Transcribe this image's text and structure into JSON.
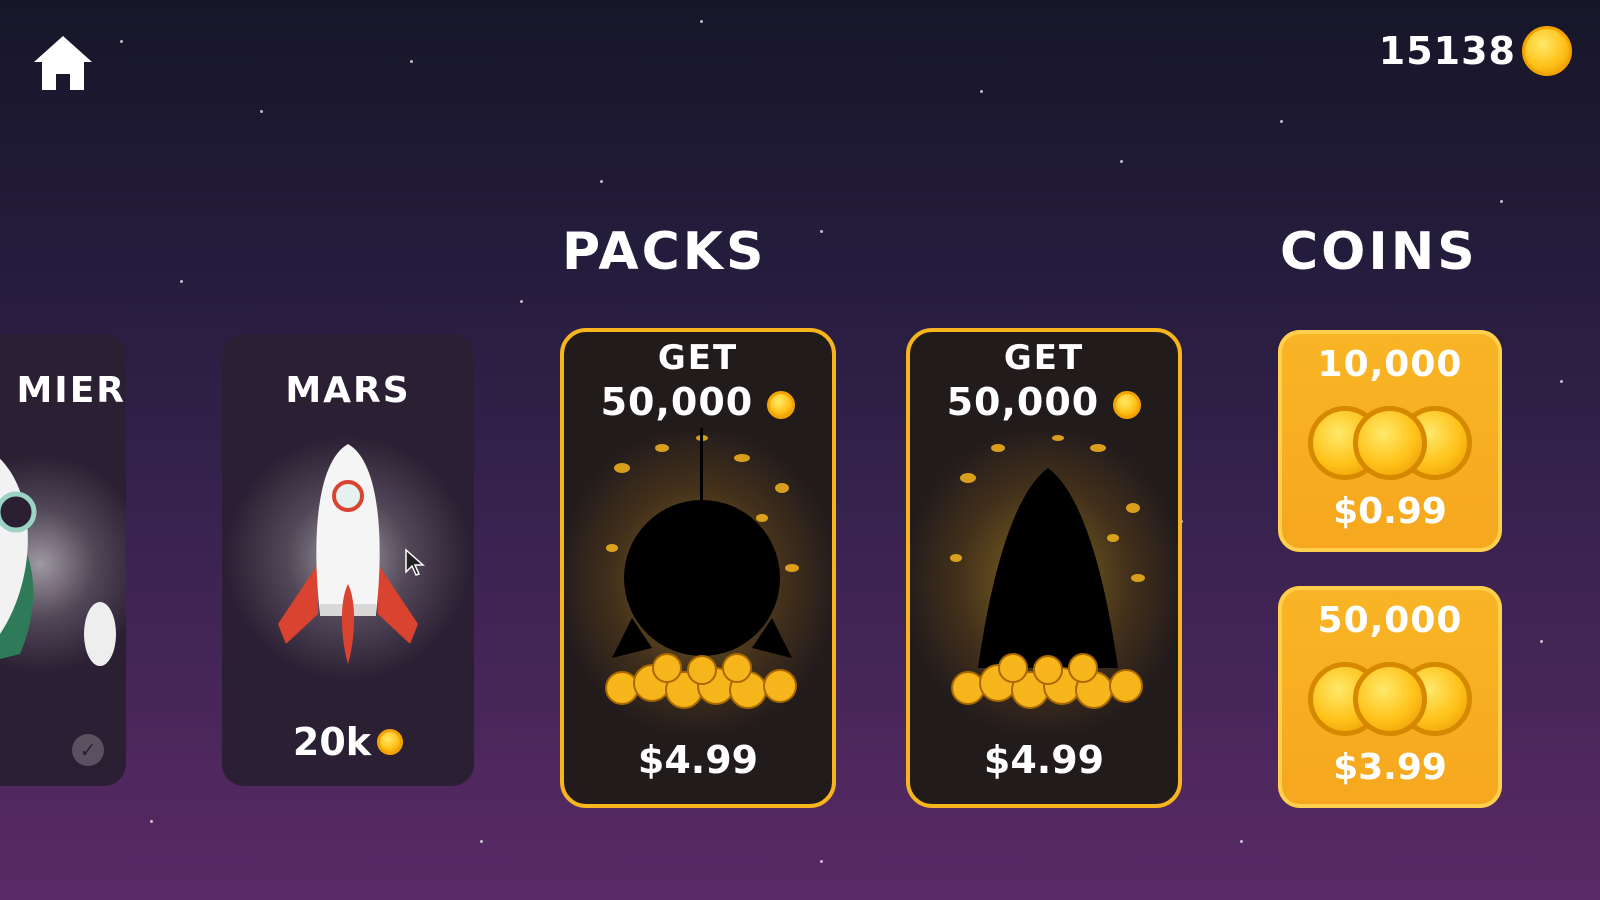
{
  "balance": {
    "amount": "15138",
    "icon": "coin-icon"
  },
  "home": {
    "icon": "home-icon"
  },
  "sections": {
    "packs_title": "PACKS",
    "coins_title": "COINS"
  },
  "ships": [
    {
      "name": "MIER",
      "owned": true
    },
    {
      "name": "MARS",
      "price": "20k",
      "owned": false
    }
  ],
  "packs": [
    {
      "get_label": "GET",
      "amount": "50,000",
      "price": "$4.99",
      "silhouette": "round-ship-silhouette"
    },
    {
      "get_label": "GET",
      "amount": "50,000",
      "price": "$4.99",
      "silhouette": "pointed-ship-silhouette"
    }
  ],
  "coin_offers": [
    {
      "amount": "10,000",
      "price": "$0.99"
    },
    {
      "amount": "50,000",
      "price": "$3.99"
    }
  ],
  "colors": {
    "gold": "#f6b51c",
    "card_dark": "#2b1f33",
    "rocket_red": "#d9432f"
  }
}
